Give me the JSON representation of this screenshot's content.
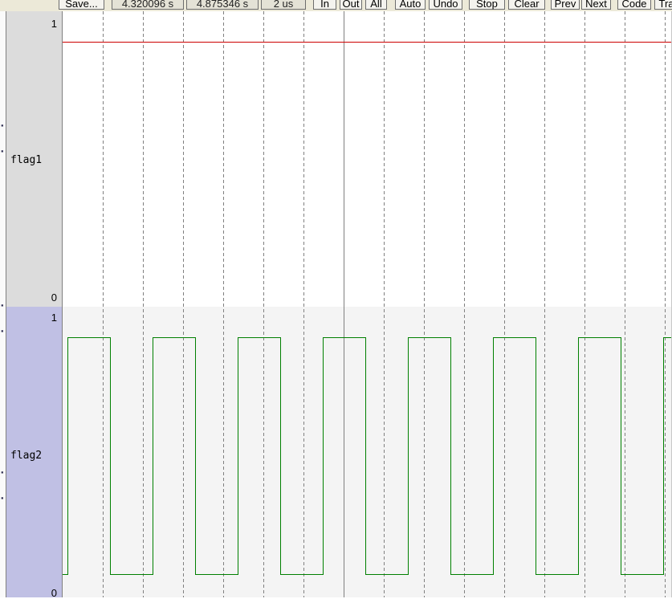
{
  "toolbar": {
    "save_label": "Save...",
    "time_start": "4.320096 s",
    "time_end": "4.875346 s",
    "grid_label": "2 us",
    "zoom_in": "In",
    "zoom_out": "Out",
    "zoom_all": "All",
    "auto": "Auto",
    "undo": "Undo",
    "stop": "Stop",
    "clear": "Clear",
    "prev": "Prev",
    "next": "Next",
    "code": "Code",
    "trace": "Tra"
  },
  "signals": [
    {
      "name": "flag1",
      "max_label": "1",
      "min_label": "0",
      "color": "#cc0000",
      "level": 1
    },
    {
      "name": "flag2",
      "max_label": "1",
      "min_label": "0",
      "color": "#008000"
    }
  ],
  "colors": {
    "flag1_panel": "#dcdcdc",
    "flag2_panel": "#c0c0e4",
    "grid": "#808080",
    "cursor": "#808080"
  }
}
